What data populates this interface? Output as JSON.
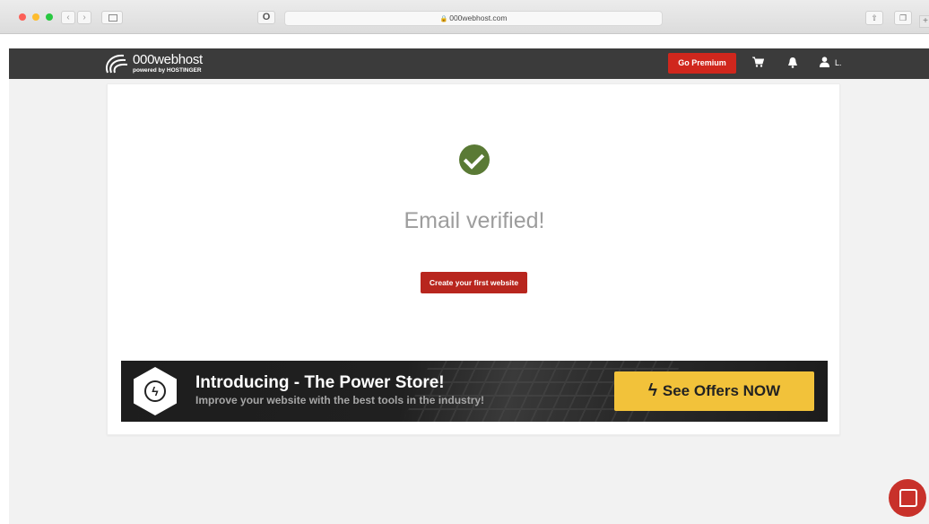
{
  "browser": {
    "url": "000webhost.com",
    "back_glyph": "‹",
    "forward_glyph": "›",
    "opera_glyph": "O",
    "share_glyph": "⇧",
    "tabs_glyph": "❐",
    "newtab_glyph": "+"
  },
  "header": {
    "logo_name": "000webhost",
    "logo_sub": "powered by HOSTINGER",
    "premium_label": "Go Premium",
    "user_initial": "L."
  },
  "main": {
    "heading": "Email verified!",
    "create_label": "Create your first website"
  },
  "banner": {
    "title": "Introducing - The Power Store!",
    "subtitle": "Improve your website with the best tools in the industry!",
    "cta_label": "See Offers NOW"
  },
  "icons": {
    "logo": "swirl-logo-icon",
    "cart": "cart-icon",
    "bell": "bell-icon",
    "user": "user-icon",
    "check": "check-circle-icon",
    "power_store": "power-hex-icon",
    "bolt": "bolt-icon",
    "chat": "chat-icon"
  },
  "colors": {
    "header_bg": "#3b3b3b",
    "brand_red": "#d0271d",
    "check_green": "#5a7a35",
    "cta_yellow": "#f2c23a"
  }
}
